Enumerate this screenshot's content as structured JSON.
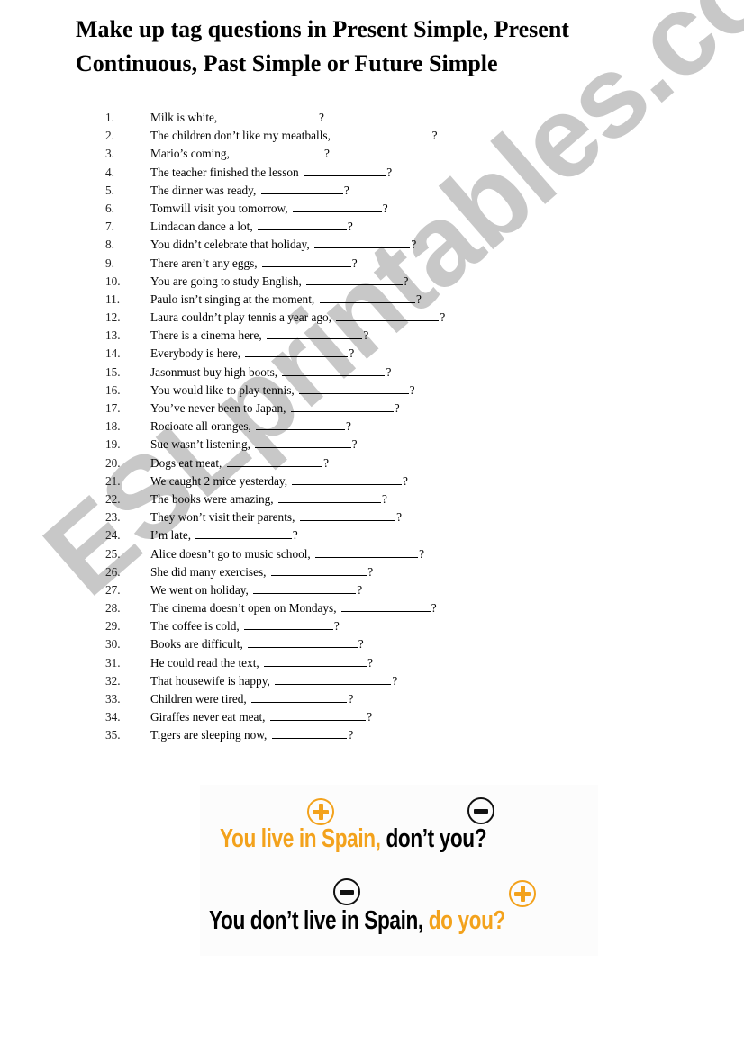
{
  "title": "Make up tag questions in Present Simple, Present Continuous, Past Simple or Future Simple",
  "watermark": "ESLprintables.com",
  "exercise": {
    "blank_char": "_",
    "question_mark": "?",
    "items": [
      {
        "num": "1.",
        "text": "Milk is white,",
        "blank": 14
      },
      {
        "num": "2.",
        "text": "The children don’t like my meatballs,",
        "blank": 14
      },
      {
        "num": "3.",
        "text": "Mario’s coming,",
        "blank": 13
      },
      {
        "num": "4.",
        "text": "The teacher finished the lesson",
        "blank": 12
      },
      {
        "num": "5.",
        "text": "The dinner was ready,",
        "blank": 12
      },
      {
        "num": "6.",
        "text": "Tomwill visit you tomorrow,",
        "blank": 13
      },
      {
        "num": "7.",
        "text": "Lindacan dance a lot,",
        "blank": 13
      },
      {
        "num": "8.",
        "text": "You didn’t celebrate that holiday,",
        "blank": 14
      },
      {
        "num": "9.",
        "text": "There aren’t any eggs,",
        "blank": 13
      },
      {
        "num": "10.",
        "text": "You are going to study English,",
        "blank": 14
      },
      {
        "num": "11.",
        "text": "Paulo isn’t singing at the moment,",
        "blank": 14
      },
      {
        "num": "12.",
        "text": "Laura couldn’t play tennis a year ago,",
        "blank": 15
      },
      {
        "num": "13.",
        "text": "There is a cinema here,",
        "blank": 14
      },
      {
        "num": "14.",
        "text": "Everybody is here,",
        "blank": 15
      },
      {
        "num": "15.",
        "text": "Jasonmust buy high boots,",
        "blank": 15
      },
      {
        "num": "16.",
        "text": "You would like to play tennis,",
        "blank": 16
      },
      {
        "num": "17.",
        "text": "You’ve never been to Japan,",
        "blank": 15
      },
      {
        "num": "18.",
        "text": "Rocioate all oranges,",
        "blank": 13
      },
      {
        "num": "19.",
        "text": "Sue wasn’t listening,",
        "blank": 14
      },
      {
        "num": "20.",
        "text": "Dogs eat meat,",
        "blank": 14
      },
      {
        "num": "21.",
        "text": "We caught 2 mice yesterday,",
        "blank": 16
      },
      {
        "num": "22.",
        "text": "The books were amazing,",
        "blank": 15
      },
      {
        "num": "23.",
        "text": "They won’t visit their parents,",
        "blank": 14
      },
      {
        "num": "24.",
        "text": "I’m late,",
        "blank": 14
      },
      {
        "num": "25.",
        "text": "Alice doesn’t go to music school,",
        "blank": 15
      },
      {
        "num": "26.",
        "text": "She did many exercises,",
        "blank": 14
      },
      {
        "num": "27.",
        "text": "We went on holiday,",
        "blank": 15
      },
      {
        "num": "28.",
        "text": "The cinema doesn’t open on Mondays,",
        "blank": 13
      },
      {
        "num": "29.",
        "text": "The coffee is cold,",
        "blank": 13
      },
      {
        "num": "30.",
        "text": "Books are difficult,",
        "blank": 16
      },
      {
        "num": "31.",
        "text": "He could read the text,",
        "blank": 15
      },
      {
        "num": "32.",
        "text": "That housewife is happy,",
        "blank": 17
      },
      {
        "num": "33.",
        "text": "Children were tired,",
        "blank": 14
      },
      {
        "num": "34.",
        "text": "Giraffes never eat meat,",
        "blank": 14
      },
      {
        "num": "35.",
        "text": "Tigers are sleeping now,",
        "blank": 11
      }
    ]
  },
  "rule_image": {
    "line1": {
      "statement": "You live in Spain,",
      "tag": " don’t you?",
      "statement_sign": "plus",
      "tag_sign": "minus"
    },
    "line2": {
      "statement": "You don’t  live in Spain,",
      "tag": " do you?",
      "statement_sign": "minus",
      "tag_sign": "plus"
    },
    "colors": {
      "positive": "#f3a21c",
      "negative": "#000000"
    }
  }
}
